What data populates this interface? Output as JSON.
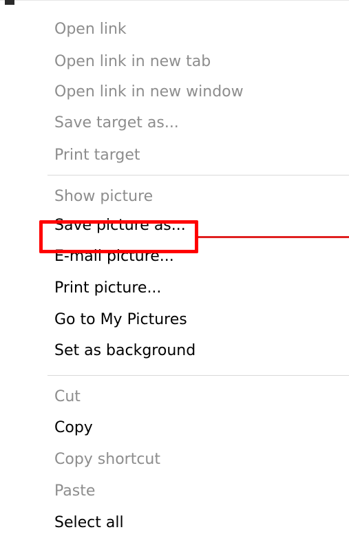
{
  "menu": {
    "groups": [
      {
        "items": [
          {
            "label": "Open link",
            "enabled": false
          },
          {
            "label": "Open link in new tab",
            "enabled": false
          },
          {
            "label": "Open link in new window",
            "enabled": false
          },
          {
            "label": "Save target as...",
            "enabled": false
          },
          {
            "label": "Print target",
            "enabled": false
          }
        ]
      },
      {
        "items": [
          {
            "label": "Show picture",
            "enabled": false
          },
          {
            "label": "Save picture as...",
            "enabled": true
          },
          {
            "label": "E-mail picture...",
            "enabled": true
          },
          {
            "label": "Print picture...",
            "enabled": true
          },
          {
            "label": "Go to My Pictures",
            "enabled": true
          },
          {
            "label": "Set as background",
            "enabled": true
          }
        ]
      },
      {
        "items": [
          {
            "label": "Cut",
            "enabled": false
          },
          {
            "label": "Copy",
            "enabled": true
          },
          {
            "label": "Copy shortcut",
            "enabled": false
          },
          {
            "label": "Paste",
            "enabled": false
          },
          {
            "label": "Select all",
            "enabled": true
          }
        ]
      }
    ]
  },
  "annotation": {
    "highlighted_item": "Save picture as...",
    "color": "#ff0000"
  },
  "colors": {
    "disabled_text": "#8d8d8d",
    "enabled_text": "#000000",
    "separator": "#d9d9d9"
  }
}
